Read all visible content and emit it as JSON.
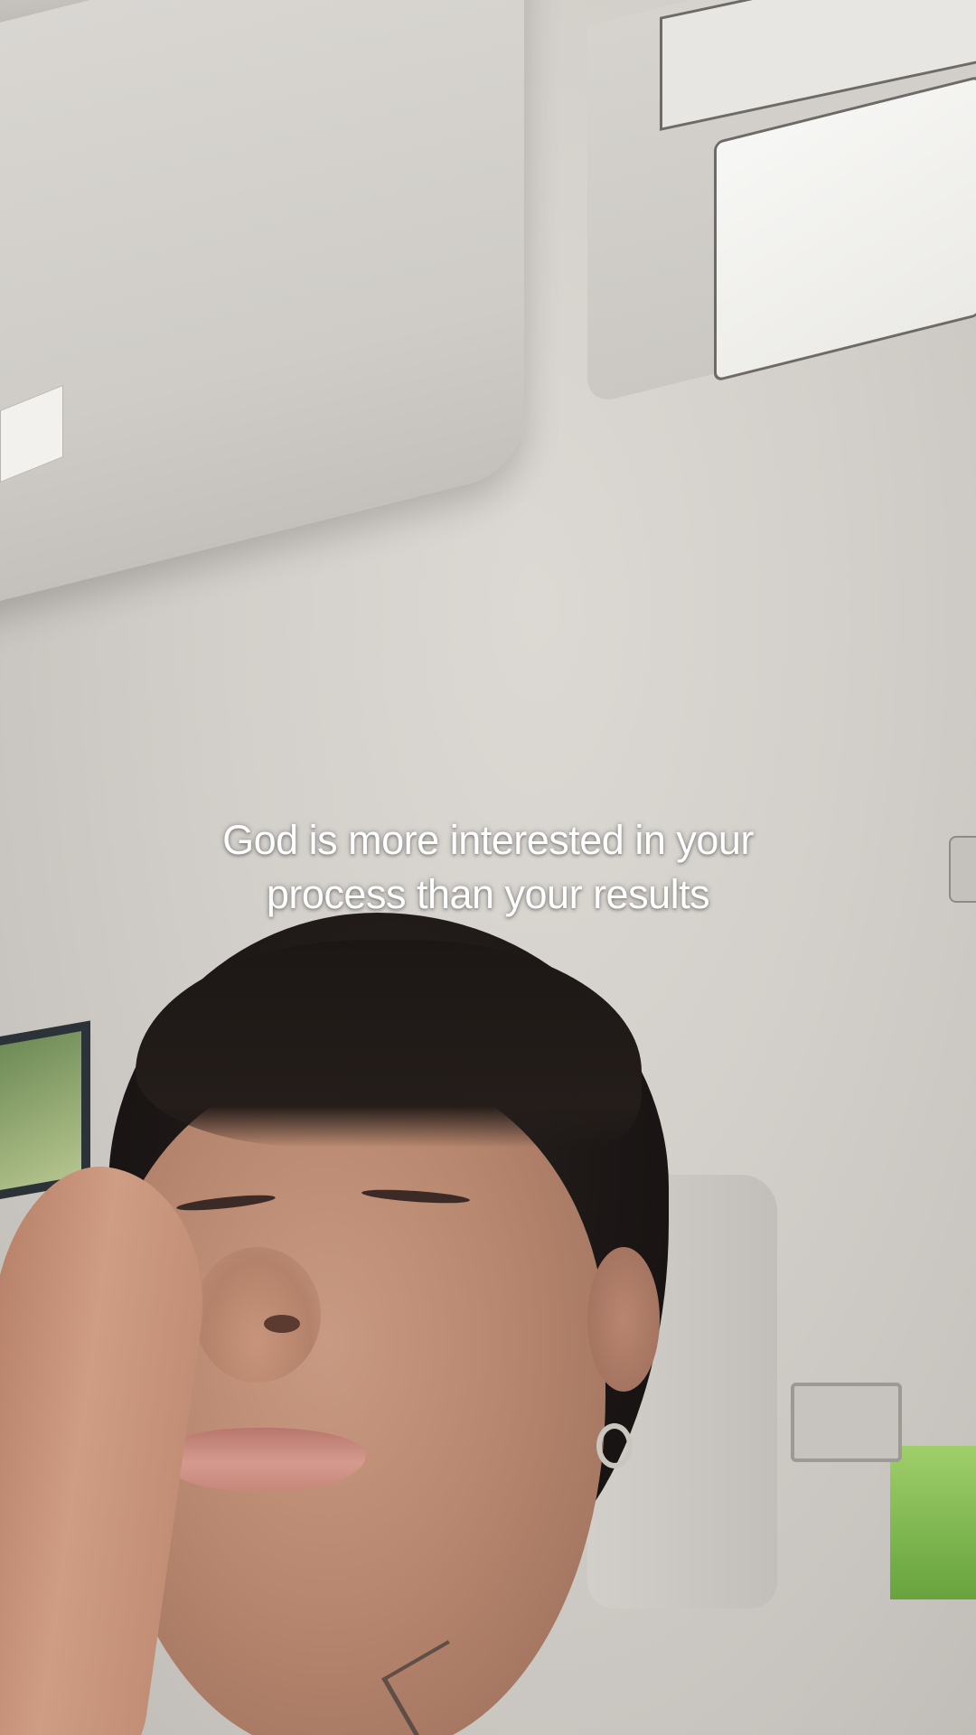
{
  "caption": {
    "line1": "God is more interested in your",
    "line2": "process than your results",
    "color": "#ffffff"
  }
}
